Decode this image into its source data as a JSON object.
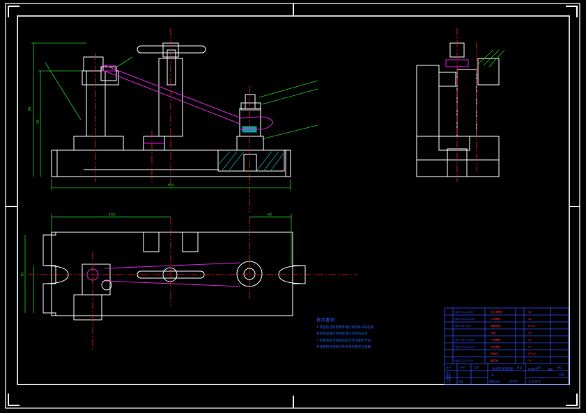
{
  "colors": {
    "background": "#000000",
    "outline": "#ffffff",
    "centerline": "#ff2020",
    "clamp": "#e020e0",
    "dimension": "#20d020",
    "hatch": "#10a0a0",
    "title_block": "#3050ff"
  },
  "dimensions": {
    "overall_length": "300",
    "overall_height": "85",
    "inner_height": "35",
    "plan_length": "160",
    "plan_width": "70",
    "bore_offset": "42"
  },
  "notes": {
    "heading": "技术要求:",
    "line1": "1.装配前对所有零件进行清洗并去除毛刺",
    "line2": "夹具体应进行时效处理以消除内应力",
    "line3": "2.装配后各活动部位应灵活可靠无卡滞",
    "line4": "夹紧机构应保证工件夹紧可靠定位准确"
  },
  "bom": {
    "rows": [
      {
        "std": "GB/T70.1-2000",
        "name": "内六角螺钉",
        "mat": "35"
      },
      {
        "std": "GB/T 5783-2000",
        "name": "六角螺栓",
        "mat": "45"
      },
      {
        "std": "GB/T 93-1987",
        "name": "弹簧垫圈",
        "mat": "65Mn"
      },
      {
        "std": "",
        "name": "压板",
        "mat": "45"
      },
      {
        "std": "GB/T 6170-2000",
        "name": "六角螺母",
        "mat": "45"
      },
      {
        "std": "GB/T 5782-2000",
        "name": "双头螺柱",
        "mat": "45"
      },
      {
        "std": "",
        "name": "夹具体",
        "mat": "HT200"
      },
      {
        "std": "GB/T 119-2000",
        "name": "圆柱销",
        "mat": "35"
      }
    ],
    "header": [
      "序号",
      "代号",
      "名称",
      "数量",
      "材料",
      "备注"
    ]
  },
  "title_block": {
    "drawing_title": "钻床夹具装配图",
    "subtitle": "JJ",
    "labels": [
      "设计",
      "校核",
      "审核",
      "工艺",
      "批准"
    ],
    "scale_label": "比例",
    "sheet_label": "共 张 第 张",
    "stage_label": "阶段标记",
    "weight_label": "重量",
    "school": "课程设计",
    "code": "00000"
  }
}
